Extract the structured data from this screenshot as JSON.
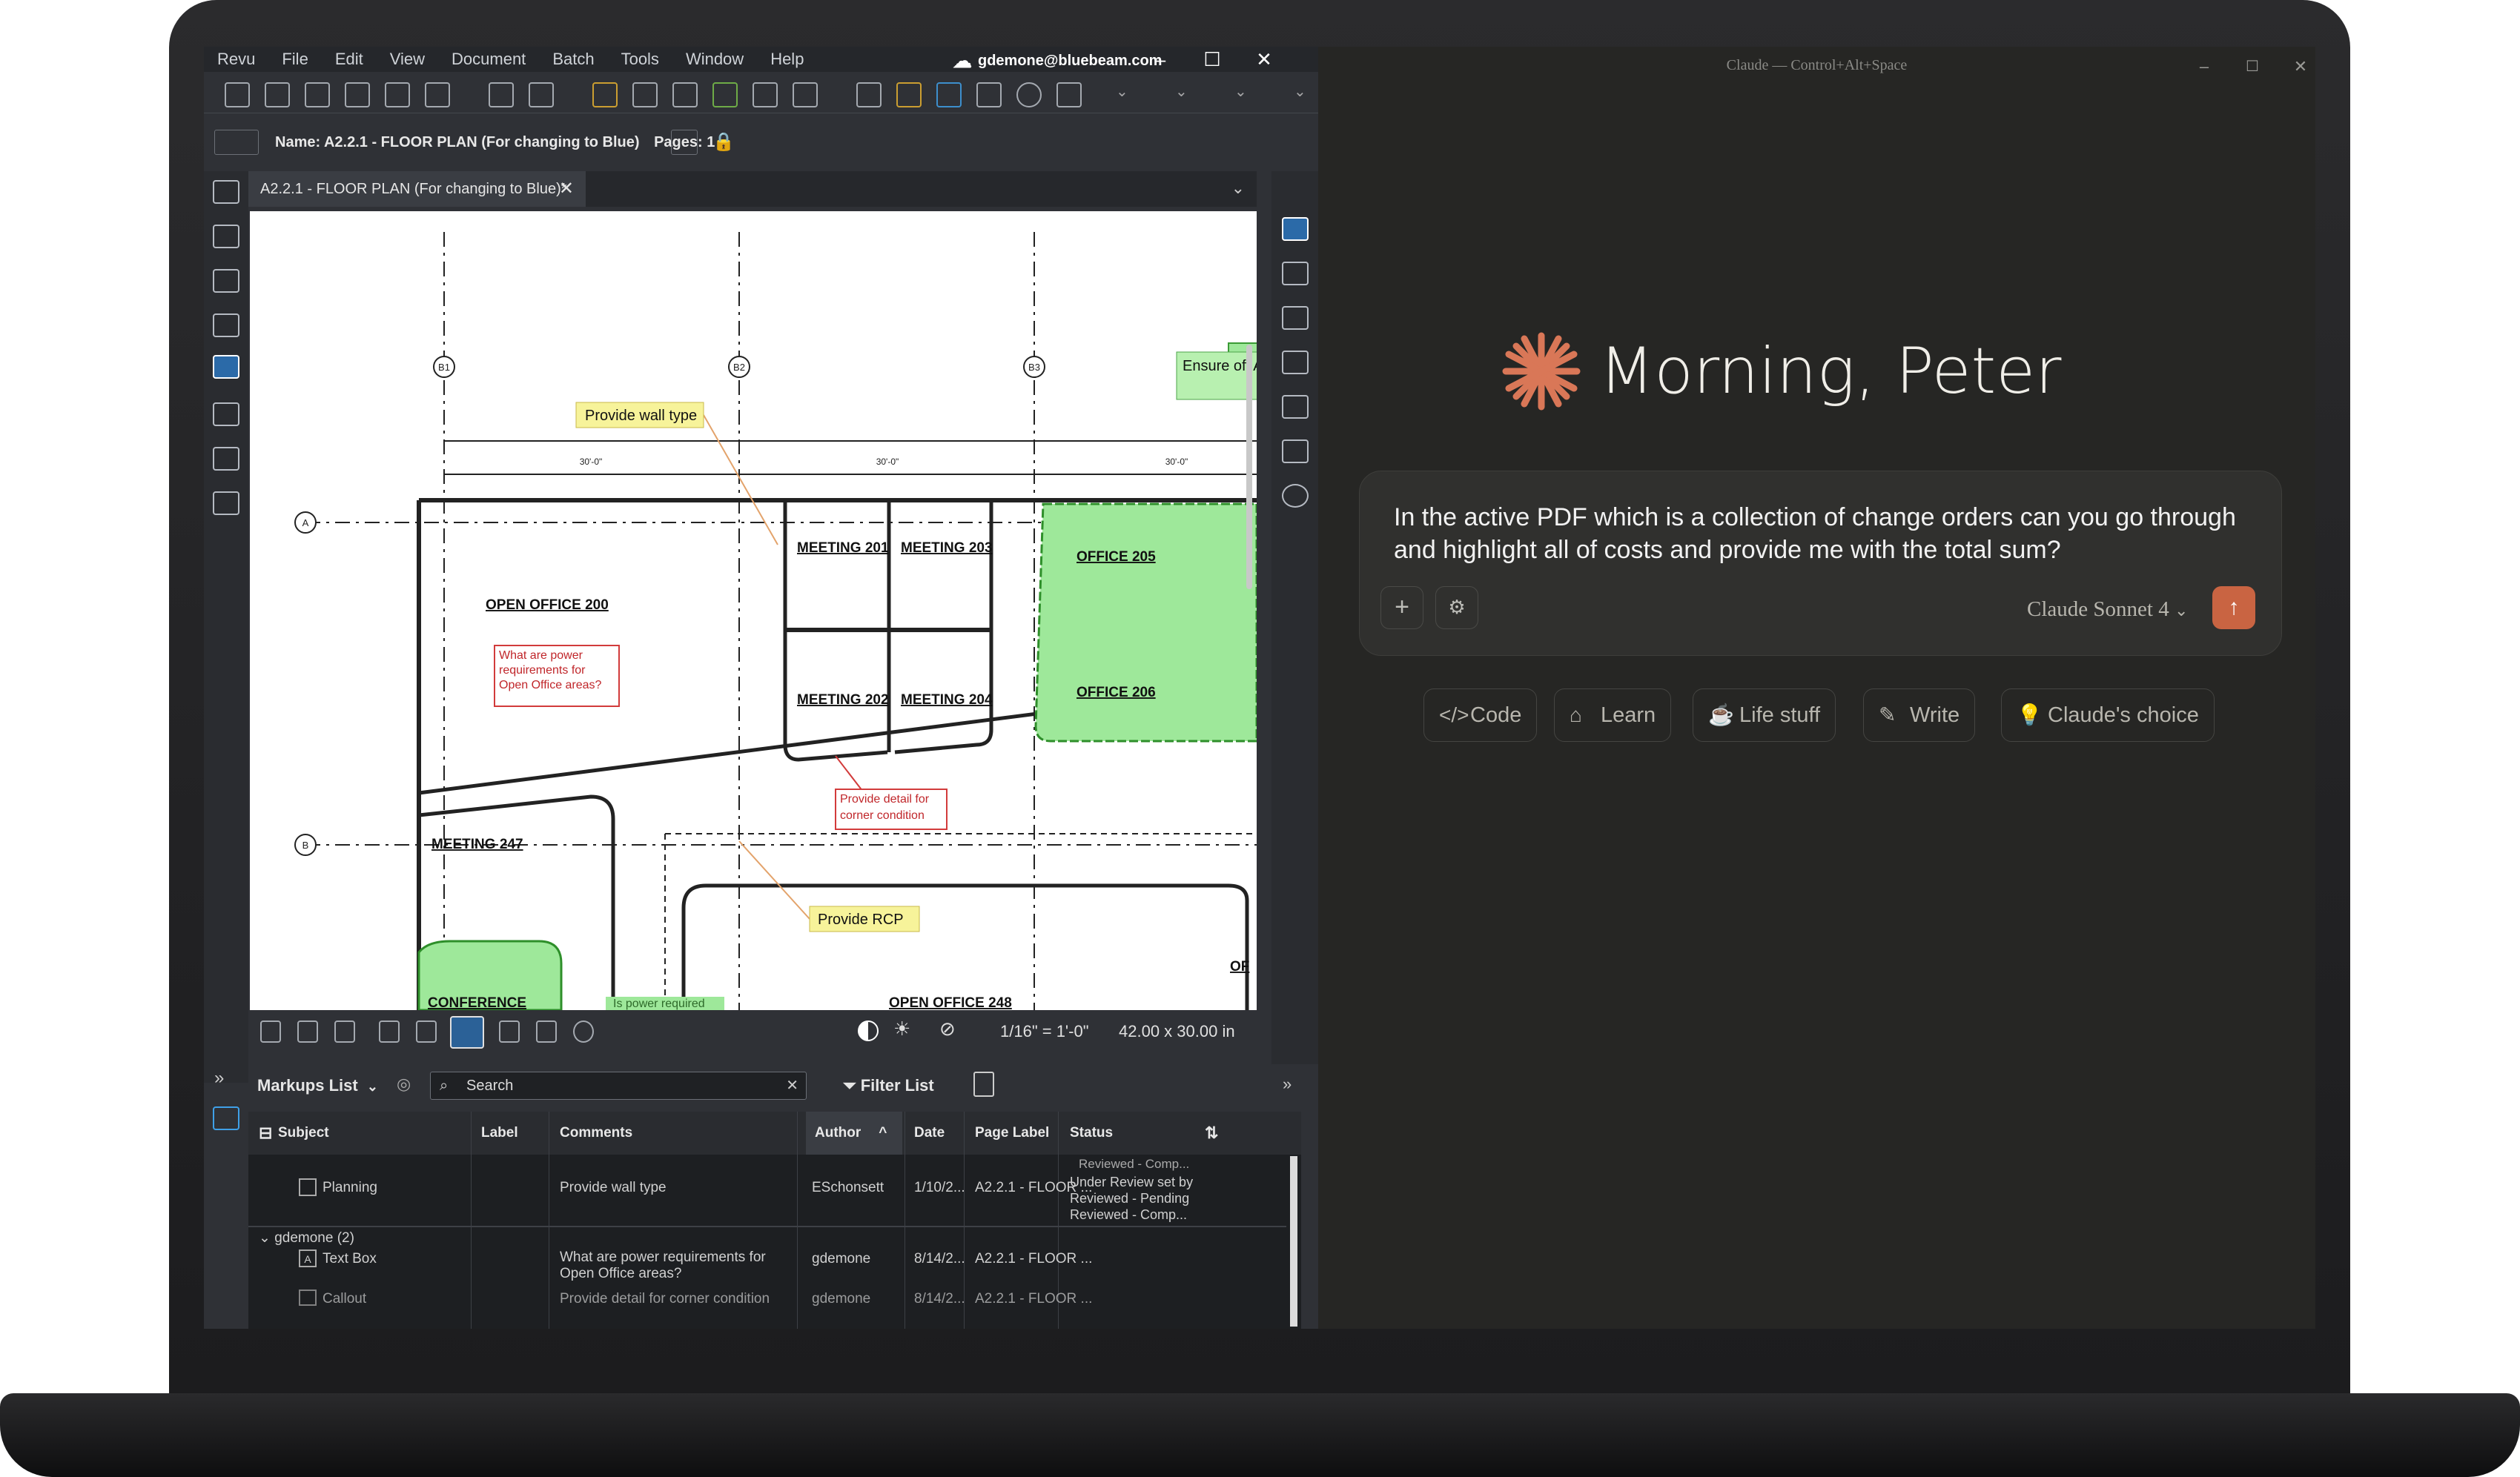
{
  "bluebeam": {
    "menu": [
      "Revu",
      "File",
      "Edit",
      "View",
      "Document",
      "Batch",
      "Tools",
      "Window",
      "Help"
    ],
    "account": "gdemone@bluebeam.com",
    "doc_name_label": "Name:",
    "doc_name": "A2.2.1 - FLOOR PLAN (For changing to Blue)",
    "pages_label": "Pages:",
    "pages": "1",
    "tab_title": "A2.2.1 - FLOOR PLAN (For changing to Blue)*",
    "drawing": {
      "callout_wall": "Provide wall type",
      "callout_ada": "Ensure off ADA acce",
      "callout_power": "What are power requirements for Open Office areas?",
      "callout_corner": "Provide detail for corner condition",
      "callout_rcp": "Provide RCP",
      "rooms": [
        "MEETING 201",
        "MEETING 203",
        "OFFICE 205",
        "MEETING 202",
        "MEETING 204",
        "OFFICE 206",
        "OPEN OFFICE 200",
        "MEETING 247",
        "CONFERENCE",
        "OPEN OFFICE 248",
        "OF"
      ],
      "grid_cols": [
        "B1",
        "B2",
        "B3"
      ],
      "grid_rows": [
        "A",
        "B"
      ],
      "dims": [
        "30'-0\"",
        "30'-0\"",
        "30'-0\""
      ],
      "power_note": "Is power required"
    },
    "view": {
      "scale": "1/16\" = 1'-0\"",
      "size": "42.00 x 30.00 in"
    },
    "markups": {
      "title": "Markups List",
      "search_placeholder": "Search",
      "filter": "Filter List",
      "columns": [
        "Subject",
        "Label",
        "Comments",
        "Author",
        "Date",
        "Page Label",
        "Status"
      ],
      "status_top": "Reviewed - Comp...",
      "rows": [
        {
          "subject": "Planning",
          "label": "",
          "comments": "Provide wall type",
          "author": "ESchonsett",
          "date": "1/10/2...",
          "page": "A2.2.1 - FLOOR ...",
          "status": [
            "Under Review set by",
            "Reviewed - Pending",
            "Reviewed - Comp..."
          ]
        },
        {
          "group": "gdemone (2)"
        },
        {
          "subject": "Text Box",
          "label": "",
          "comments": "What are power requirements for Open Office areas?",
          "author": "gdemone",
          "date": "8/14/2...",
          "page": "A2.2.1 - FLOOR ...",
          "status": []
        },
        {
          "subject": "Callout",
          "label": "",
          "comments": "Provide detail for corner condition",
          "author": "gdemone",
          "date": "8/14/2...",
          "page": "A2.2.1 - FLOOR ...",
          "status": []
        }
      ]
    }
  },
  "claude": {
    "title": "Claude — Control+Alt+Space",
    "greeting": "Morning, Peter",
    "prompt": "In the active PDF which is a collection of change orders can you go through and highlight all of costs and provide me with the total sum?",
    "model": "Claude Sonnet 4",
    "chips": [
      {
        "icon": "code-icon",
        "label": "Code"
      },
      {
        "icon": "learn-icon",
        "label": "Learn"
      },
      {
        "icon": "coffee-icon",
        "label": "Life stuff"
      },
      {
        "icon": "pen-icon",
        "label": "Write"
      },
      {
        "icon": "bulb-icon",
        "label": "Claude's choice"
      }
    ],
    "accent": "#c96442"
  }
}
